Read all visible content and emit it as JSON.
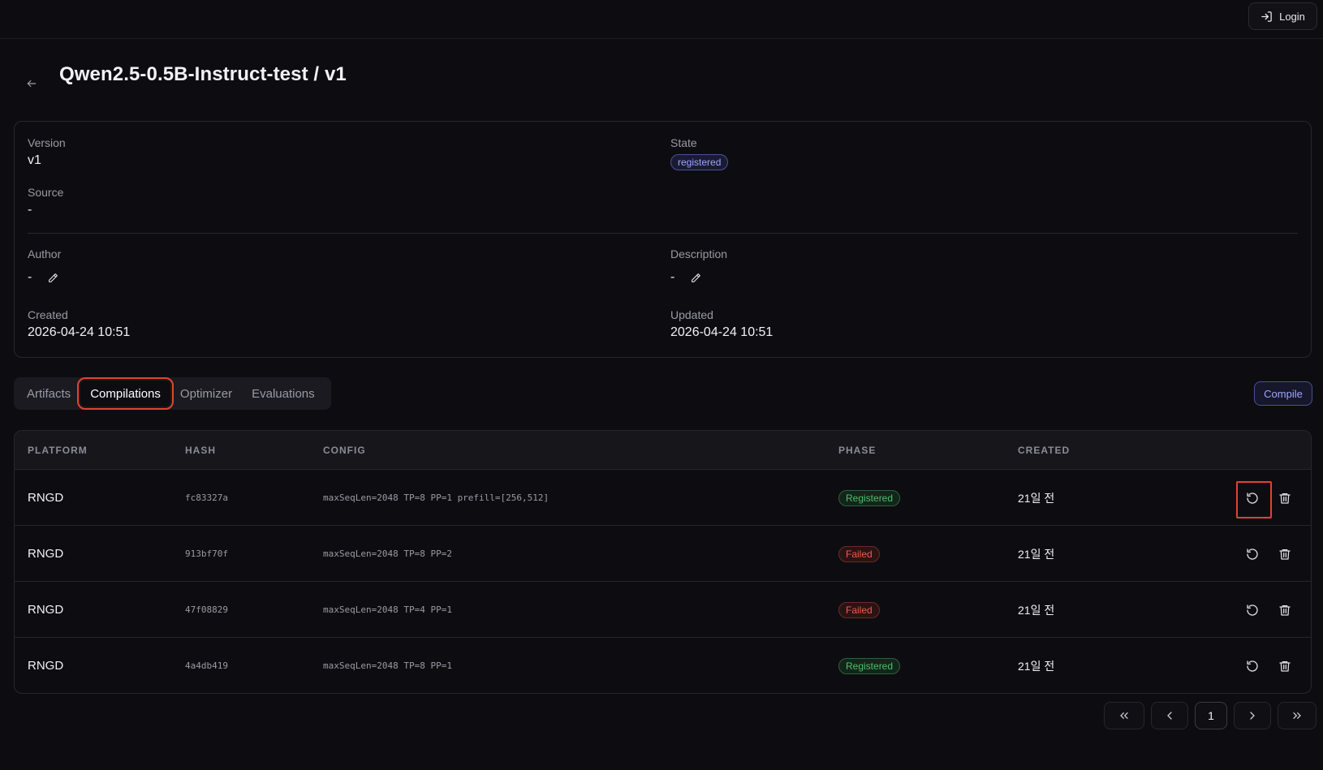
{
  "header": {
    "login_label": "Login"
  },
  "page": {
    "title": "Qwen2.5-0.5B-Instruct-test / v1"
  },
  "info": {
    "version_label": "Version",
    "version_value": "v1",
    "state_label": "State",
    "state_value": "registered",
    "source_label": "Source",
    "source_value": "-",
    "author_label": "Author",
    "author_value": "-",
    "description_label": "Description",
    "description_value": "-",
    "created_label": "Created",
    "created_value": "2026-04-24 10:51",
    "updated_label": "Updated",
    "updated_value": "2026-04-24 10:51"
  },
  "tabs": [
    {
      "label": "Artifacts"
    },
    {
      "label": "Compilations",
      "active": true
    },
    {
      "label": "Optimizer"
    },
    {
      "label": "Evaluations"
    }
  ],
  "compile_label": "Compile",
  "table": {
    "headers": [
      "PLATFORM",
      "HASH",
      "CONFIG",
      "PHASE",
      "CREATED"
    ],
    "rows": [
      {
        "platform": "RNGD",
        "hash": "fc83327a",
        "config": "maxSeqLen=2048 TP=8 PP=1 prefill=[256,512]",
        "phase": "Registered",
        "created": "21일 전"
      },
      {
        "platform": "RNGD",
        "hash": "913bf70f",
        "config": "maxSeqLen=2048 TP=8 PP=2",
        "phase": "Failed",
        "created": "21일 전"
      },
      {
        "platform": "RNGD",
        "hash": "47f08829",
        "config": "maxSeqLen=2048 TP=4 PP=1",
        "phase": "Failed",
        "created": "21일 전"
      },
      {
        "platform": "RNGD",
        "hash": "4a4db419",
        "config": "maxSeqLen=2048 TP=8 PP=1",
        "phase": "Registered",
        "created": "21일 전"
      }
    ]
  },
  "pagination": {
    "current_page": "1"
  },
  "colors": {
    "accent": "#9fa6ff",
    "success": "#4fbf6a",
    "danger": "#f05a4f",
    "highlight": "#e0442c"
  }
}
